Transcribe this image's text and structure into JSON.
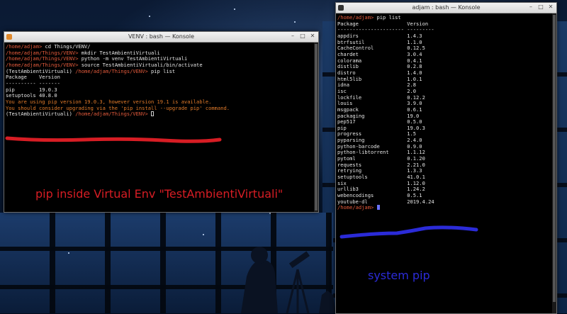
{
  "left_window": {
    "title": "VENV : bash — Konsole",
    "lines": [
      {
        "path": "/home/adjam>",
        "cmd": " cd Things/VENV/"
      },
      {
        "path": "/home/adjam/Things/VENV>",
        "cmd": " mkdir TestAmbientiVirtuali"
      },
      {
        "path": "/home/adjam/Things/VENV>",
        "cmd": " python -m venv TestAmbientiVirtuali"
      },
      {
        "path": "/home/adjam/Things/VENV>",
        "cmd": " source TestAmbientiVirtuali/bin/activate"
      }
    ],
    "venv_prefix": "(TestAmbientiVirtuali) ",
    "venv_path": "/home/adjam/Things/VENV>",
    "venv_cmd": " pip list",
    "header": "Package    Version",
    "separator": "---------- -------",
    "packages": [
      "pip        19.0.3",
      "setuptools 40.8.0"
    ],
    "warning1": "You are using pip version 19.0.3, however version 19.1 is available.",
    "warning2": "You should consider upgrading via the 'pip install --upgrade pip' command.",
    "final_prefix": "(TestAmbientiVirtuali) ",
    "final_path": "/home/adjam/Things/VENV>",
    "final_cmd": " "
  },
  "right_window": {
    "title": "adjam : bash — Konsole",
    "prompt_path": "/home/adjam>",
    "command": " pip list",
    "header": "Package                Version",
    "separator": "---------------------- ---------",
    "packages": [
      "appdirs                1.4.3",
      "btrfsutil              1.1.0",
      "CacheControl           0.12.5",
      "chardet                3.0.4",
      "colorama               0.4.1",
      "distlib                0.2.8",
      "distro                 1.4.0",
      "html5lib               1.0.1",
      "idna                   2.8",
      "isc                    2.0",
      "lockfile               0.12.2",
      "louis                  3.9.0",
      "msgpack                0.6.1",
      "packaging              19.0",
      "pep517                 0.5.0",
      "pip                    19.0.3",
      "progress               1.5",
      "pyparsing              2.4.0",
      "python-barcode         0.9.0",
      "python-libtorrent      1.1.12",
      "pytoml                 0.1.20",
      "requests               2.21.0",
      "retrying               1.3.3",
      "setuptools             41.0.1",
      "six                    1.12.0",
      "urllib3                1.24.2",
      "webencodings           0.5.1",
      "youtube-dl             2019.4.24"
    ],
    "final_path": "/home/adjam>",
    "final_cmd": " "
  },
  "annotations": {
    "red_label": "pip inside Virtual Env \"TestAmbientiVirtuali\"",
    "blue_label": "system pip"
  },
  "colors": {
    "prompt": "#e55b3c",
    "warning": "#e07a2a",
    "red_marker": "#d71d24",
    "blue_marker": "#2b2bd8"
  }
}
